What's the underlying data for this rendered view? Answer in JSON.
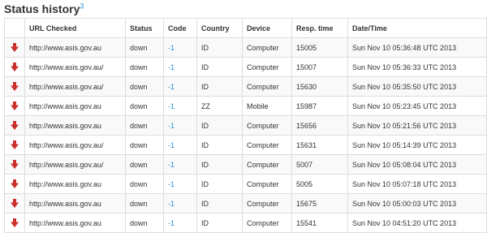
{
  "header": {
    "title": "Status history",
    "count": "3"
  },
  "table": {
    "columns": [
      "",
      "URL Checked",
      "Status",
      "Code",
      "Country",
      "Device",
      "Resp. time",
      "Date/Time"
    ],
    "rows": [
      {
        "icon": "arrow-down-icon",
        "url": "http://www.asis.gov.au",
        "status": "down",
        "code": "-1",
        "country": "ID",
        "device": "Computer",
        "resp_time": "15005",
        "datetime": "Sun Nov 10 05:36:48 UTC 2013"
      },
      {
        "icon": "arrow-down-icon",
        "url": "http://www.asis.gov.au/",
        "status": "down",
        "code": "-1",
        "country": "ID",
        "device": "Computer",
        "resp_time": "15007",
        "datetime": "Sun Nov 10 05:36:33 UTC 2013"
      },
      {
        "icon": "arrow-down-icon",
        "url": "http://www.asis.gov.au/",
        "status": "down",
        "code": "-1",
        "country": "ID",
        "device": "Computer",
        "resp_time": "15630",
        "datetime": "Sun Nov 10 05:35:50 UTC 2013"
      },
      {
        "icon": "arrow-down-icon",
        "url": "http://www.asis.gov.au",
        "status": "down",
        "code": "-1",
        "country": "ZZ",
        "device": "Mobile",
        "resp_time": "15987",
        "datetime": "Sun Nov 10 05:23:45 UTC 2013"
      },
      {
        "icon": "arrow-down-icon",
        "url": "http://www.asis.gov.au",
        "status": "down",
        "code": "-1",
        "country": "ID",
        "device": "Computer",
        "resp_time": "15656",
        "datetime": "Sun Nov 10 05:21:56 UTC 2013"
      },
      {
        "icon": "arrow-down-icon",
        "url": "http://www.asis.gov.au/",
        "status": "down",
        "code": "-1",
        "country": "ID",
        "device": "Computer",
        "resp_time": "15631",
        "datetime": "Sun Nov 10 05:14:39 UTC 2013"
      },
      {
        "icon": "arrow-down-icon",
        "url": "http://www.asis.gov.au/",
        "status": "down",
        "code": "-1",
        "country": "ID",
        "device": "Computer",
        "resp_time": "5007",
        "datetime": "Sun Nov 10 05:08:04 UTC 2013"
      },
      {
        "icon": "arrow-down-icon",
        "url": "http://www.asis.gov.au",
        "status": "down",
        "code": "-1",
        "country": "ID",
        "device": "Computer",
        "resp_time": "5005",
        "datetime": "Sun Nov 10 05:07:18 UTC 2013"
      },
      {
        "icon": "arrow-down-icon",
        "url": "http://www.asis.gov.au",
        "status": "down",
        "code": "-1",
        "country": "ID",
        "device": "Computer",
        "resp_time": "15675",
        "datetime": "Sun Nov 10 05:00:03 UTC 2013"
      },
      {
        "icon": "arrow-down-icon",
        "url": "http://www.asis.gov.au",
        "status": "down",
        "code": "-1",
        "country": "ID",
        "device": "Computer",
        "resp_time": "15541",
        "datetime": "Sun Nov 10 04:51:20 UTC 2013"
      }
    ]
  },
  "colors": {
    "down_arrow": "#c9302c",
    "link": "#2a8fd6",
    "border": "#dddddd",
    "stripe": "#f9f9f9"
  }
}
